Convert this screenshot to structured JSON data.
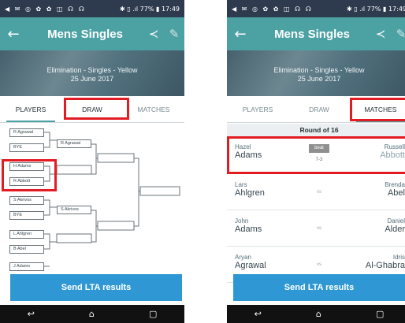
{
  "status_bar": {
    "icons": "◀ ✉ ◎ ✿ ✿ ◫ ☊ ☊",
    "right": "✱ ▯ .ıl 77% ▮ 17:49"
  },
  "app": {
    "title": "Mens Singles",
    "back_icon": "←",
    "share_icon": "≺",
    "edit_icon": "✎"
  },
  "event": {
    "line1": "Elimination - Singles - Yellow",
    "line2": "25 June 2017"
  },
  "tabs": [
    {
      "label": "PLAYERS"
    },
    {
      "label": "DRAW"
    },
    {
      "label": "MATCHES"
    }
  ],
  "draw": {
    "round1": [
      "R Agrawal",
      "BYE",
      "H Adams",
      "R Abbott",
      "S Akrivos",
      "BYE",
      "L Ahlgren",
      "B Abel",
      "J Adams"
    ],
    "round2": [
      "R Agrawal",
      "",
      "S Akrivos",
      ""
    ]
  },
  "matches": {
    "round_label": "Round of 16",
    "rows": [
      {
        "p1_first": "Hazel",
        "p1_last": "Adams",
        "p2_first": "Russell",
        "p2_last": "Abbott",
        "badge": "beat",
        "score": "7-3"
      },
      {
        "p1_first": "Lars",
        "p1_last": "Ahlgren",
        "p2_first": "Brenda",
        "p2_last": "Abel",
        "vs": "vs"
      },
      {
        "p1_first": "John",
        "p1_last": "Adams",
        "p2_first": "Daniel",
        "p2_last": "Alder",
        "vs": "vs"
      },
      {
        "p1_first": "Aryan",
        "p1_last": "Agrawal",
        "p2_first": "Idris",
        "p2_last": "Al-Ghabra",
        "vs": "vs"
      }
    ]
  },
  "cta": {
    "label": "Send LTA results"
  },
  "nav": {
    "back": "↩",
    "home": "⌂",
    "recent": "▢"
  },
  "colors": {
    "app_bar": "#4ca1a3",
    "cta": "#2f98d4",
    "highlight": "#e31b23",
    "status_bar": "#2e3b4e"
  }
}
